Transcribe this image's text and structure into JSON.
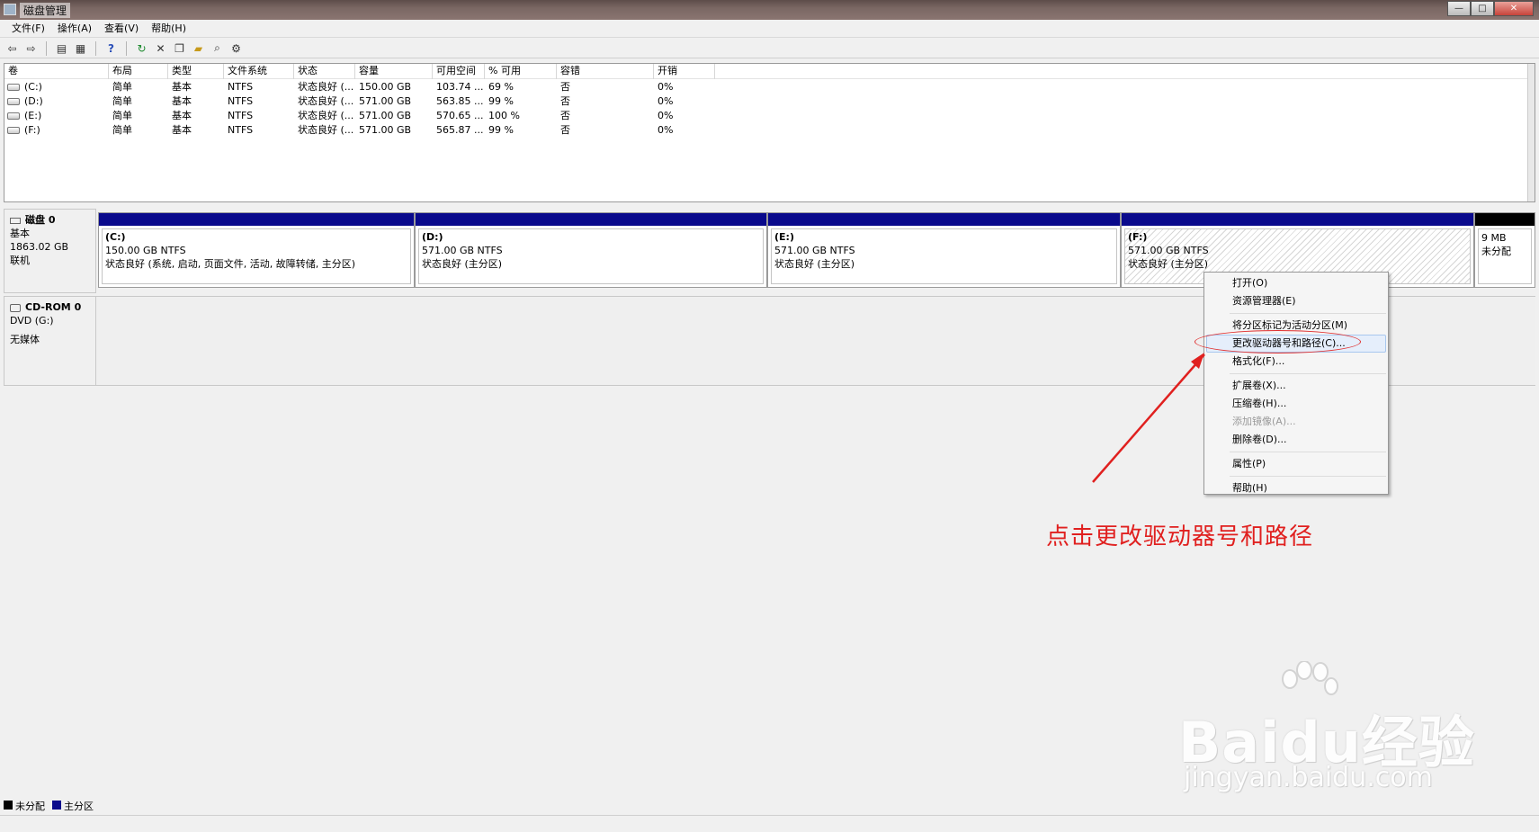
{
  "window": {
    "title": "磁盘管理",
    "buttons": [
      "—",
      "□",
      "✕"
    ]
  },
  "menubar": [
    "文件(F)",
    "操作(A)",
    "查看(V)",
    "帮助(H)"
  ],
  "toolbar_icons": [
    "back-icon",
    "forward-icon",
    "console-tree-icon",
    "properties-icon",
    "help-icon",
    "refresh-icon",
    "delete-icon",
    "copy-icon",
    "open-icon",
    "search-icon",
    "settings-icon"
  ],
  "volume_list": {
    "columns": [
      "卷",
      "布局",
      "类型",
      "文件系统",
      "状态",
      "容量",
      "可用空间",
      "% 可用",
      "容错",
      "开销"
    ],
    "rows": [
      [
        "(C:)",
        "简单",
        "基本",
        "NTFS",
        "状态良好 (...",
        "150.00 GB",
        "103.74 ...",
        "69 %",
        "否",
        "0%"
      ],
      [
        "(D:)",
        "简单",
        "基本",
        "NTFS",
        "状态良好 (...",
        "571.00 GB",
        "563.85 ...",
        "99 %",
        "否",
        "0%"
      ],
      [
        "(E:)",
        "简单",
        "基本",
        "NTFS",
        "状态良好 (...",
        "571.00 GB",
        "570.65 ...",
        "100 %",
        "否",
        "0%"
      ],
      [
        "(F:)",
        "简单",
        "基本",
        "NTFS",
        "状态良好 (...",
        "571.00 GB",
        "565.87 ...",
        "99 %",
        "否",
        "0%"
      ]
    ]
  },
  "disk0": {
    "name": "磁盘 0",
    "type": "基本",
    "size": "1863.02 GB",
    "status": "联机",
    "partitions": [
      {
        "name": "(C:)",
        "size": "150.00 GB NTFS",
        "status": "状态良好 (系统, 启动, 页面文件, 活动, 故障转储, 主分区)"
      },
      {
        "name": "(D:)",
        "size": "571.00 GB NTFS",
        "status": "状态良好 (主分区)"
      },
      {
        "name": "(E:)",
        "size": "571.00 GB NTFS",
        "status": "状态良好 (主分区)"
      },
      {
        "name": "(F:)",
        "size": "571.00 GB NTFS",
        "status": "状态良好 (主分区)"
      },
      {
        "name": "",
        "size": "9 MB",
        "status": "未分配"
      }
    ]
  },
  "cdrom0": {
    "name": "CD-ROM 0",
    "drive": "DVD (G:)",
    "media": "无媒体"
  },
  "context_menu": [
    {
      "label": "打开(O)",
      "enabled": true
    },
    {
      "label": "资源管理器(E)",
      "enabled": true
    },
    {
      "sep": true
    },
    {
      "label": "将分区标记为活动分区(M)",
      "enabled": true
    },
    {
      "label": "更改驱动器号和路径(C)...",
      "enabled": true,
      "highlight": true
    },
    {
      "label": "格式化(F)...",
      "enabled": true
    },
    {
      "sep": true
    },
    {
      "label": "扩展卷(X)...",
      "enabled": true
    },
    {
      "label": "压缩卷(H)...",
      "enabled": true
    },
    {
      "label": "添加镜像(A)...",
      "enabled": false
    },
    {
      "label": "删除卷(D)...",
      "enabled": true
    },
    {
      "sep": true
    },
    {
      "label": "属性(P)",
      "enabled": true
    },
    {
      "sep": true
    },
    {
      "label": "帮助(H)",
      "enabled": true
    }
  ],
  "legend": [
    "未分配",
    "主分区"
  ],
  "annotation": {
    "text": "点击更改驱动器号和路径",
    "color": "#e0201f"
  },
  "watermark": {
    "main": "Baidu经验",
    "sub": "jingyan.baidu.com"
  },
  "colors": {
    "primary_partition": "#0a0a8c",
    "unallocated": "#000000"
  }
}
